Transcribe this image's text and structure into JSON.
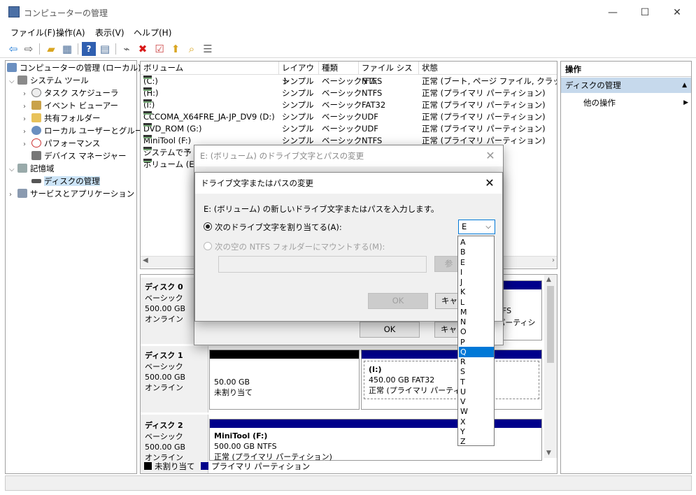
{
  "window": {
    "title": "コンピューターの管理",
    "minimize": "—",
    "maximize": "☐",
    "close": "✕"
  },
  "menu": [
    "ファイル(F)",
    "操作(A)",
    "表示(V)",
    "ヘルプ(H)"
  ],
  "toolbar_icons": [
    "back-arrow-icon",
    "forward-arrow-icon",
    "up-folder-icon",
    "show-hide-tree-icon",
    "help-icon",
    "properties-icon",
    "connect-icon",
    "delete-icon",
    "checklist-icon",
    "export-icon",
    "find-icon",
    "view-list-icon"
  ],
  "tree": {
    "root": "コンピューターの管理 (ローカル)",
    "system_tools": "システム ツール",
    "task_scheduler": "タスク スケジューラ",
    "event_viewer": "イベント ビューアー",
    "shared_folders": "共有フォルダー",
    "local_users": "ローカル ユーザーとグループ",
    "performance": "パフォーマンス",
    "device_manager": "デバイス マネージャー",
    "storage": "記憶域",
    "disk_mgmt": "ディスクの管理",
    "services": "サービスとアプリケーション"
  },
  "volumes": {
    "headers": [
      "ボリューム",
      "レイアウト",
      "種類",
      "ファイル システム",
      "状態"
    ],
    "rows": [
      [
        "(C:)",
        "シンプル",
        "ベーシック",
        "NTFS",
        "正常 (ブート, ページ ファイル, クラッシュ ダ"
      ],
      [
        "(H:)",
        "シンプル",
        "ベーシック",
        "NTFS",
        "正常 (プライマリ パーティション)"
      ],
      [
        "(I:)",
        "シンプル",
        "ベーシック",
        "FAT32",
        "正常 (プライマリ パーティション)"
      ],
      [
        "CCCOMA_X64FRE_JA-JP_DV9 (D:)",
        "シンプル",
        "ベーシック",
        "UDF",
        "正常 (プライマリ パーティション)"
      ],
      [
        "DVD_ROM (G:)",
        "シンプル",
        "ベーシック",
        "UDF",
        "正常 (プライマリ パーティション)"
      ],
      [
        "MiniTool (F:)",
        "シンプル",
        "ベーシック",
        "NTFS",
        "正常 (プライマリ パーティション)"
      ],
      [
        "システムで予",
        "",
        "",
        "",
        ", プライマリ パーテ"
      ],
      [
        "ボリューム (E",
        "",
        "",
        "",
        ")"
      ]
    ]
  },
  "disks": [
    {
      "name": "ディスク 0",
      "type": "ベーシック",
      "size": "500.00 GB",
      "status": "オンライン"
    },
    {
      "name": "ディスク 1",
      "type": "ベーシック",
      "size": "500.00 GB",
      "status": "オンライン",
      "p1": {
        "size": "50.00 GB",
        "status": "未割り当て"
      },
      "p2": {
        "label": "(I:)",
        "size": "450.00 GB FAT32",
        "status": "正常 (プライマリ パーティショ"
      }
    },
    {
      "name": "ディスク 2",
      "type": "ベーシック",
      "size": "500.00 GB",
      "status": "オンライン",
      "p1": {
        "label": "MiniTool  (F:)",
        "size": "500.00 GB NTFS",
        "status": "正常 (プライマリ パーティション)"
      }
    }
  ],
  "disk0_partial": {
    "text1": "FS",
    "text2": "| パーティシ"
  },
  "legend": {
    "unallocated": "未割り当て",
    "primary": "プライマリ パーティション"
  },
  "actions": {
    "header": "操作",
    "section": "ディスクの管理",
    "other": "他の操作"
  },
  "back_dialog": {
    "title": "E: (ボリューム) のドライブ文字とパスの変更",
    "ok": "OK",
    "cancel_partial": "キャ"
  },
  "dialog": {
    "title": "ドライブ文字またはパスの変更",
    "instruction": "E: (ボリューム) の新しいドライブ文字またはパスを入力します。",
    "radio_assign": "次のドライブ文字を割り当てる(A):",
    "radio_mount": "次の空の NTFS フォルダーにマウントする(M):",
    "browse_partial": "参",
    "ok": "OK",
    "cancel_partial": "キャ",
    "selected_letter": "E"
  },
  "dropdown": {
    "options": [
      "A",
      "B",
      "E",
      "I",
      "J",
      "K",
      "L",
      "M",
      "N",
      "O",
      "P",
      "Q",
      "R",
      "S",
      "T",
      "U",
      "V",
      "W",
      "X",
      "Y",
      "Z"
    ],
    "highlighted": "Q"
  },
  "colors": {
    "primary_partition": "#00008b",
    "unallocated": "#000000",
    "selection": "#0078d7",
    "actions_section": "#c6d9ec"
  }
}
